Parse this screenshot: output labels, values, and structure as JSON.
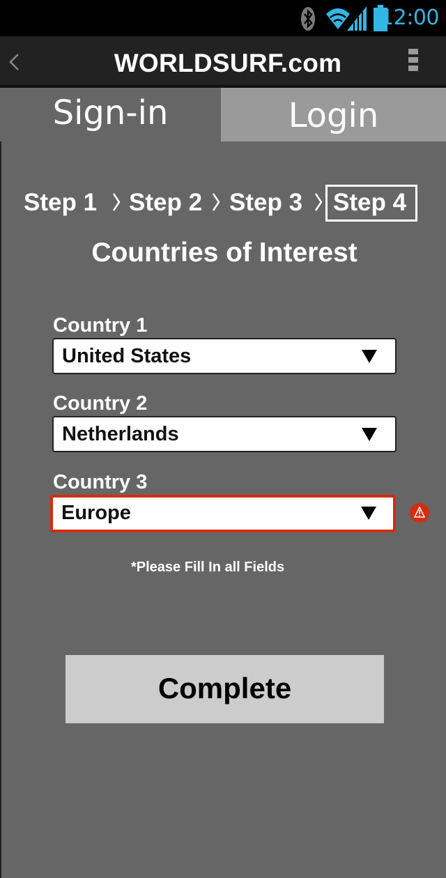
{
  "status_bar": {
    "time": "12:00",
    "icons": [
      "bluetooth-icon",
      "wifi-icon",
      "signal-icon",
      "battery-icon"
    ],
    "time_color": "#33b5e5"
  },
  "action_bar": {
    "title": "WORLDSURF.com",
    "back_icon": "chevron-left-icon",
    "menu_icon": "overflow-menu-icon"
  },
  "tabs": [
    {
      "label": "Sign-in",
      "active": true
    },
    {
      "label": "Login",
      "active": false
    }
  ],
  "steps": {
    "items": [
      "Step 1",
      "Step 2",
      "Step 3",
      "Step 4"
    ],
    "current": "Step 4"
  },
  "form": {
    "title": "Countries of Interest",
    "fields": [
      {
        "label": "Country 1",
        "value": "United States",
        "error": false
      },
      {
        "label": "Country 2",
        "value": "Netherlands",
        "error": false
      },
      {
        "label": "Country 3",
        "value": "Europe",
        "error": true
      }
    ],
    "hint": "*Please Fill In all Fields",
    "submit_label": "Complete"
  },
  "colors": {
    "background": "#666666",
    "inactive_tab": "#9a9a9a",
    "error": "#d62c10",
    "button": "#cccccc"
  }
}
